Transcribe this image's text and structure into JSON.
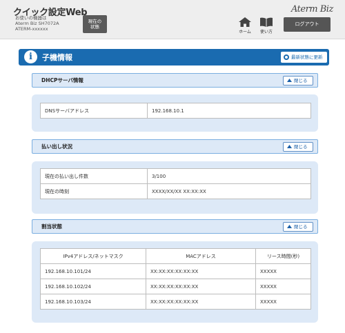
{
  "header": {
    "title": "クイック設定Web",
    "device_label": "お使いの機器は",
    "device_model": "Aterm Biz SH7072A",
    "device_id": "ATERM-xxxxxx",
    "status_button": [
      "現在の",
      "状態"
    ],
    "home_label": "ホーム",
    "manual_label": "使い方",
    "brand": "Aterm Biz",
    "logout_label": "ログアウト"
  },
  "banner": {
    "icon": "i",
    "title": "子機情報",
    "refresh_label": "最新状態に更新"
  },
  "sections": {
    "dhcp": {
      "title": "DHCPサーバ情報",
      "close_label": "閉じる",
      "rows": [
        [
          "DNSサーバアドレス",
          "192.168.10.1"
        ]
      ]
    },
    "lease": {
      "title": "払い出し状況",
      "close_label": "閉じる",
      "rows": [
        [
          "現在の払い出し件数",
          "3/100"
        ],
        [
          "現在の時刻",
          "XXXX/XX/XX XX:XX:XX"
        ]
      ]
    },
    "assign": {
      "title": "割当状態",
      "close_label": "閉じる",
      "headers": [
        "IPv4アドレス/ネットマスク",
        "MACアドレス",
        "リース時間(秒)"
      ],
      "rows": [
        [
          "192.168.10.101/24",
          "XX:XX:XX:XX:XX:XX",
          "XXXXX"
        ],
        [
          "192.168.10.102/24",
          "XX:XX:XX:XX:XX:XX",
          "XXXXX"
        ],
        [
          "192.168.10.103/24",
          "XX:XX:XX:XX:XX:XX",
          "XXXXX"
        ]
      ]
    }
  },
  "icons": {
    "home": "home-icon",
    "manual": "book-icon",
    "info": "info-icon",
    "refresh": "refresh-icon",
    "collapse": "chevron-up-icon"
  },
  "colors": {
    "accent": "#1a6bb0",
    "panel": "#dde9f7",
    "header_bg": "#eeeeee",
    "button_dark": "#555555"
  }
}
